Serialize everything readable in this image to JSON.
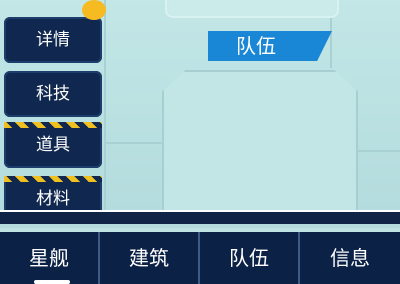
{
  "side_tabs": [
    "详情",
    "科技",
    "道具",
    "材料"
  ],
  "panel": {
    "title": "队伍"
  },
  "bottom_tabs": [
    "星舰",
    "建筑",
    "队伍",
    "信息"
  ],
  "active_bottom_tab": "星舰",
  "colors": {
    "panel_bg": "#c3e6e6",
    "tab_dark": "#10284f",
    "title_blue": "#1a86d6",
    "hazard_yellow": "#f0c020",
    "notif_yellow": "#f5bb20"
  }
}
